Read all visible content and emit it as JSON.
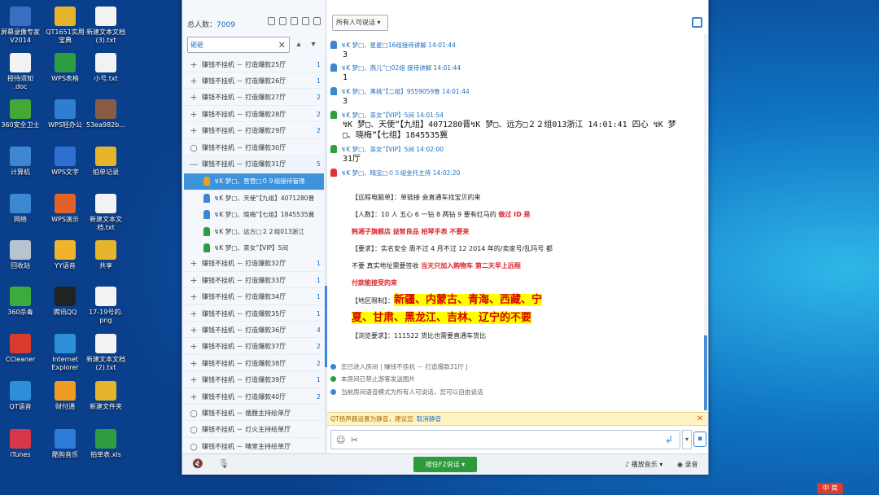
{
  "desktop": [
    {
      "label": "屏幕录像专家\nV2014",
      "color": "#3a6ec0"
    },
    {
      "label": "QT1651实用\n宝典",
      "color": "#e6b42a"
    },
    {
      "label": "新建文本文档\n(3).txt",
      "color": "#f2f2f2"
    },
    {
      "label": "授待须知\n.doc",
      "color": "#f2f2f2"
    },
    {
      "label": "WPS表格",
      "color": "#2e9d41"
    },
    {
      "label": "小号.txt",
      "color": "#f2f2f2"
    },
    {
      "label": "360安全卫士",
      "color": "#44a838"
    },
    {
      "label": "WPS轻办公",
      "color": "#2f7fd1"
    },
    {
      "label": "53ea982b...",
      "color": "#8a5b44"
    },
    {
      "label": "计算机",
      "color": "#3d86d0"
    },
    {
      "label": "WPS文字",
      "color": "#2f6fd1"
    },
    {
      "label": "拍单记录",
      "color": "#e6b42a"
    },
    {
      "label": "网络",
      "color": "#3d86d0"
    },
    {
      "label": "WPS演示",
      "color": "#e0612a"
    },
    {
      "label": "新建文本文\n档.txt",
      "color": "#f2f2f2"
    },
    {
      "label": "回收站",
      "color": "#b7c4cf"
    },
    {
      "label": "YY语音",
      "color": "#f1b22c"
    },
    {
      "label": "共享",
      "color": "#e6b42a"
    },
    {
      "label": "360杀毒",
      "color": "#3bab3b"
    },
    {
      "label": "腾讯QQ",
      "color": "#222"
    },
    {
      "label": "17-19号的.\npng",
      "color": "#f2f2f2"
    },
    {
      "label": "CCleaner",
      "color": "#d93a2e"
    },
    {
      "label": "Internet\nExplorer",
      "color": "#2d8fd8"
    },
    {
      "label": "新建文本文档\n(2).txt",
      "color": "#f2f2f2"
    },
    {
      "label": "QT语音",
      "color": "#2d8fd8"
    },
    {
      "label": "财付通",
      "color": "#f09b21"
    },
    {
      "label": "新建文件夹",
      "color": "#e6b42a"
    },
    {
      "label": "iTunes",
      "color": "#d8374b"
    },
    {
      "label": "酷狗音乐",
      "color": "#2d7bd8"
    },
    {
      "label": "拍单表.xls",
      "color": "#2e9d41"
    }
  ],
  "left": {
    "total_label": "总人数：",
    "total": "7009",
    "search_value": "砸砸",
    "rooms": [
      {
        "label": "赚钱不挂机 － 打造爆款25厅",
        "count": "1",
        "sym": "+"
      },
      {
        "label": "赚钱不挂机 － 打造爆款26厅",
        "count": "1",
        "sym": "+"
      },
      {
        "label": "赚钱不挂机 － 打造爆款27厅",
        "count": "2",
        "sym": "+"
      },
      {
        "label": "赚钱不挂机 － 打造爆款28厅",
        "count": "2",
        "sym": "+"
      },
      {
        "label": "赚钱不挂机 － 打造爆款29厅",
        "count": "2",
        "sym": "+"
      },
      {
        "label": "赚钱不挂机 － 打造爆款30厅",
        "count": "",
        "sym": "○"
      },
      {
        "label": "赚钱不挂机 － 打造爆款31厅",
        "count": "5",
        "sym": "—"
      }
    ],
    "members": [
      {
        "label": "↯K 梦□、营营□０９组接待管理",
        "color": "#e6a21a"
      },
      {
        "label": "↯K 梦□、天使”【九组】4071280晋",
        "color": "#3d86d0"
      },
      {
        "label": "↯K 梦□、晓梅”【七组】1845535冀",
        "color": "#3d86d0"
      },
      {
        "label": "↯K 梦□、远方□２２组013浙江",
        "color": "#2e9d41"
      },
      {
        "label": "↯K 梦□、茶女”【VIP】5间",
        "color": "#2e9d41"
      }
    ],
    "rooms2": [
      {
        "label": "赚钱不挂机 － 打造爆款32厅",
        "count": "1",
        "sym": "+"
      },
      {
        "label": "赚钱不挂机 － 打造爆款33厅",
        "count": "1",
        "sym": "+"
      },
      {
        "label": "赚钱不挂机 － 打造爆款34厅",
        "count": "1",
        "sym": "+"
      },
      {
        "label": "赚钱不挂机 － 打造爆款35厅",
        "count": "1",
        "sym": "+"
      },
      {
        "label": "赚钱不挂机 － 打造爆款36厅",
        "count": "4",
        "sym": "+"
      },
      {
        "label": "赚钱不挂机 － 打造爆款37厅",
        "count": "2",
        "sym": "+"
      },
      {
        "label": "赚钱不挂机 － 打造爆款38厅",
        "count": "2",
        "sym": "+"
      },
      {
        "label": "赚钱不挂机 － 打造爆款39厅",
        "count": "1",
        "sym": "+"
      },
      {
        "label": "赚钱不挂机 － 打造爆款40厅",
        "count": "2",
        "sym": "+"
      },
      {
        "label": "赚钱不挂机 － 循膛主持绘单厅",
        "count": "",
        "sym": "○"
      },
      {
        "label": "赚钱不挂机 － 灯火主持绘单厅",
        "count": "",
        "sym": "○"
      },
      {
        "label": "赚钱不挂机 － 晴室主持绘单厅",
        "count": "",
        "sym": "○"
      }
    ]
  },
  "chat": {
    "filter": "所有人可说话 ▾",
    "messages": [
      {
        "header": "↯K 梦□、星星□16组接待讲解  14:01:44",
        "body": "3",
        "color": "#3d86d0"
      },
      {
        "header": "↯K 梦□、燕儿”□02组 接待讲解  14:01:44",
        "body": "1",
        "color": "#3d86d0"
      },
      {
        "header": "↯K 梦□、黑桃”【二组】9559059鲁  14:01:44",
        "body": "3",
        "color": "#3d86d0"
      },
      {
        "header": "↯K 梦□、茶女”【VIP】5间  14:01:54",
        "body": "↯K 梦□、天使”【九组】4071280晋↯K 梦□、远方□２２组013浙江 14:01:41 四心 ↯K 梦□、晓梅”【七组】1845535冀",
        "color": "#2e9d41"
      },
      {
        "header": "↯K 梦□、茶女”【VIP】5间  14:02:00",
        "body": "31厅",
        "color": "#2e9d41"
      },
      {
        "header": "↯K 梦□、晴宝□０５组金托主持  14:02:20",
        "body": "",
        "color": "#d33"
      }
    ],
    "ann": {
      "l1a": "【远程电脑单】：单链接  会直通车找宝贝的来",
      "l2a": "【人数】：10 人  五心 6  一钻 8   两钻 9     要有红马的",
      "l2b": "做过 ID 是",
      "l3": "韩湘子旗舰店   益智良品   柏琴手表  不要来",
      "l4a": "【要求】：实名安全  周不过 4 月不过 12   2014 年的/卖家号/乱玛号  都",
      "l5a": "不要  真实地址需要签收",
      "l5b": "当天只加入购物车  第二天早上远程",
      "l6": "付款能接受的来",
      "l7a": "【地区限制】：",
      "l7b": "新疆、内蒙古、青海、西藏、宁",
      "l8": "夏、甘肃、黑龙江、吉林、辽宁的不要",
      "l9": "【浏览要求】：111522  货比也需要直通车货比"
    },
    "system": [
      {
        "text": "您已进入房间 | 赚钱不挂机 － 打造爆款31厅 |",
        "color": "#3d86d0"
      },
      {
        "text": "本房间已禁止游客发送图片",
        "color": "#2e9d41"
      },
      {
        "text": "当前房间语音模式为所有人可说话，您可以自由说话",
        "color": "#3d86d0"
      }
    ],
    "notice": "QT扬声器设置为静音，建议您",
    "notice_link": "取消静音",
    "talk": "按住F2说话 ▾",
    "music": "♪ 播放音乐 ▾",
    "record": "◉ 录音"
  },
  "ime": "中 简"
}
